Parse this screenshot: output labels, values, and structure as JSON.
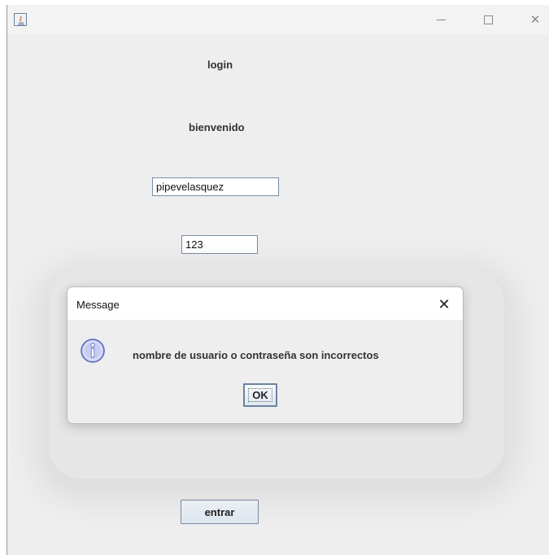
{
  "window": {
    "title": "",
    "controls": {
      "minimize": "—",
      "maximize": "☐",
      "close": "✕"
    }
  },
  "labels": {
    "login": "login",
    "bienvenido": "bienvenido"
  },
  "fields": {
    "username_value": "pipevelasquez",
    "password_value": "123"
  },
  "buttons": {
    "entrar": "entrar"
  },
  "dialog": {
    "title": "Message",
    "close": "✕",
    "message": "nombre de usuario o contraseña son incorrectos",
    "ok_label": "OK",
    "icon": "info-icon"
  },
  "colors": {
    "background": "#eeeeee",
    "field_border": "#7a8ca3",
    "info_icon_fill": "#c7cdf2",
    "info_icon_stroke": "#5a63b8"
  }
}
